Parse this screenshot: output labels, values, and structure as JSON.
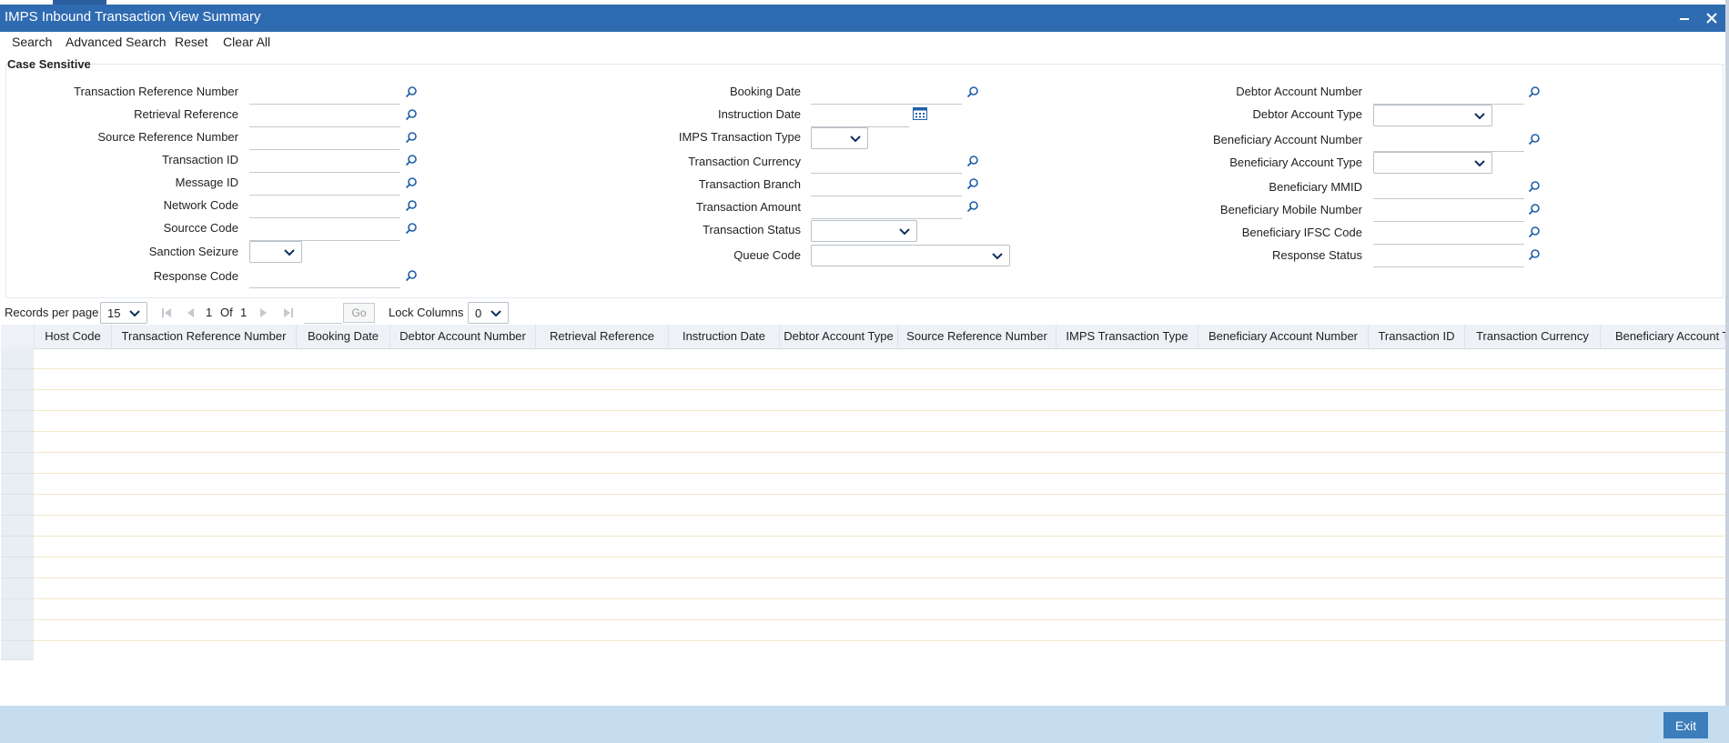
{
  "window": {
    "title": "IMPS Inbound Transaction View Summary"
  },
  "toolbar": {
    "search": "Search",
    "advanced_search": "Advanced Search",
    "reset": "Reset",
    "clear_all": "Clear All"
  },
  "form": {
    "legend": "Case Sensitive",
    "col1": {
      "transaction_reference_number": "Transaction Reference Number",
      "retrieval_reference": "Retrieval Reference",
      "source_reference_number": "Source Reference Number",
      "transaction_id": "Transaction ID",
      "message_id": "Message ID",
      "network_code": "Network Code",
      "source_code": "Sourcce Code",
      "sanction_seizure": "Sanction Seizure",
      "response_code": "Response Code"
    },
    "col2": {
      "booking_date": "Booking Date",
      "instruction_date": "Instruction Date",
      "imps_transaction_type": "IMPS Transaction Type",
      "transaction_currency": "Transaction Currency",
      "transaction_branch": "Transaction Branch",
      "transaction_amount": "Transaction Amount",
      "transaction_status": "Transaction Status",
      "queue_code": "Queue Code"
    },
    "col3": {
      "debtor_account_number": "Debtor Account Number",
      "debtor_account_type": "Debtor Account Type",
      "beneficiary_account_number": "Beneficiary Account Number",
      "beneficiary_account_type": "Beneficiary Account Type",
      "beneficiary_mmid": "Beneficiary MMID",
      "beneficiary_mobile_number": "Beneficiary Mobile Number",
      "beneficiary_ifsc_code": "Beneficiary IFSC Code",
      "response_status": "Response Status"
    }
  },
  "pager": {
    "records_per_page_label": "Records per page",
    "records_per_page_value": "15",
    "current_page": "1",
    "of_label": "Of",
    "total_pages": "1",
    "go_label": "Go",
    "lock_columns_label": "Lock Columns",
    "lock_columns_value": "0"
  },
  "table": {
    "columns": [
      "Host Code",
      "Transaction Reference Number",
      "Booking Date",
      "Debtor Account Number",
      "Retrieval Reference",
      "Instruction Date",
      "Debtor Account Type",
      "Source Reference Number",
      "IMPS Transaction Type",
      "Beneficiary Account Number",
      "Transaction ID",
      "Transaction Currency",
      "Beneficiary Account T"
    ]
  },
  "footer": {
    "exit_label": "Exit"
  },
  "colors": {
    "titlebar": "#2f6bb1",
    "footer": "#c6ddf0",
    "exit_button": "#3c7dbb",
    "accent_icon": "#1d5fa8"
  }
}
